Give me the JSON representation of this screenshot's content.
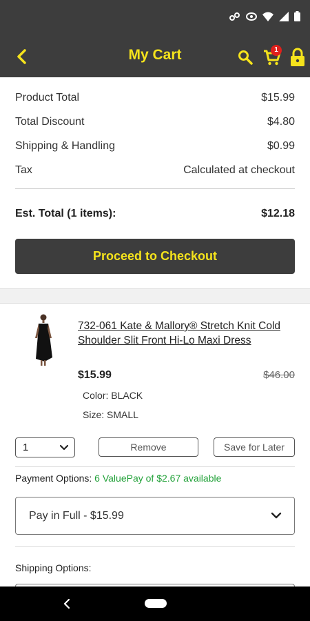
{
  "header": {
    "title": "My Cart",
    "cart_count": "1"
  },
  "summary": {
    "rows": [
      {
        "label": "Product Total",
        "value": "$15.99"
      },
      {
        "label": "Total Discount",
        "value": "$4.80"
      },
      {
        "label": "Shipping & Handling",
        "value": "$0.99"
      },
      {
        "label": "Tax",
        "value": "Calculated at checkout"
      }
    ],
    "total_label": "Est. Total (1 items):",
    "total_value": "$12.18",
    "checkout_label": "Proceed to Checkout"
  },
  "item": {
    "name": "732-061 Kate & Mallory® Stretch Knit Cold Shoulder Slit Front Hi-Lo Maxi Dress",
    "price": "$15.99",
    "original_price": "$46.00",
    "color": "Color: BLACK",
    "size": "Size: SMALL",
    "quantity": "1",
    "remove_label": "Remove",
    "save_label": "Save for Later"
  },
  "payment": {
    "label": "Payment Options:",
    "availability": "6 ValuePay of $2.67 available",
    "selected": "Pay in Full - $15.99"
  },
  "shipping": {
    "label": "Shipping Options:"
  },
  "colors": {
    "bar": "#3d3d3d",
    "accent": "#f5e31c",
    "badge": "#e0201c",
    "valuepay": "#23a23a"
  }
}
